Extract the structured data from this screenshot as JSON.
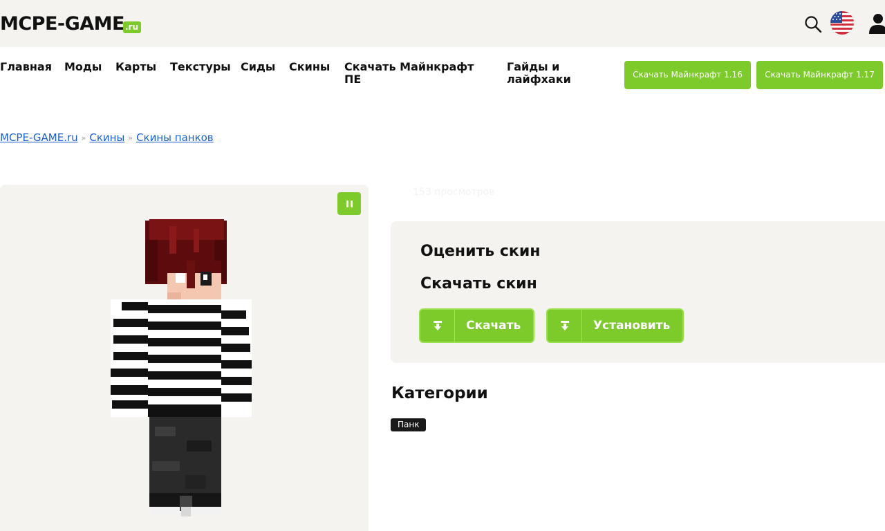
{
  "header": {
    "logo_main": "MCPE-GAME",
    "logo_suffix": ".ru"
  },
  "nav": {
    "items": [
      {
        "label": "Главная"
      },
      {
        "label": "Моды"
      },
      {
        "label": "Карты"
      },
      {
        "label": "Текстуры"
      },
      {
        "label": "Сиды"
      },
      {
        "label": "Скины"
      },
      {
        "label": "Скачать Майнкрафт ПЕ"
      },
      {
        "label": "Гайды и лайфхаки"
      }
    ],
    "buttons": [
      {
        "label": "Скачать Майнкрафт 1.16"
      },
      {
        "label": "Скачать Майнкрафт 1.17"
      }
    ]
  },
  "breadcrumb": {
    "items": [
      "MCPE-GAME.ru",
      "Скины",
      "Скины панков"
    ],
    "separator": "»"
  },
  "skin_info": {
    "views": "153 просмотров"
  },
  "card": {
    "rate_title": "Оценить скин",
    "download_title": "Скачать скин",
    "download_button": "Скачать",
    "install_button": "Установить"
  },
  "categories": {
    "title": "Категории",
    "tags": [
      "Панк"
    ]
  },
  "colors": {
    "accent_green": "#7ccb2b",
    "panel_bg": "#f5f3ef",
    "link_blue": "#1a5fd6",
    "tag_bg": "#1a1a1a"
  }
}
